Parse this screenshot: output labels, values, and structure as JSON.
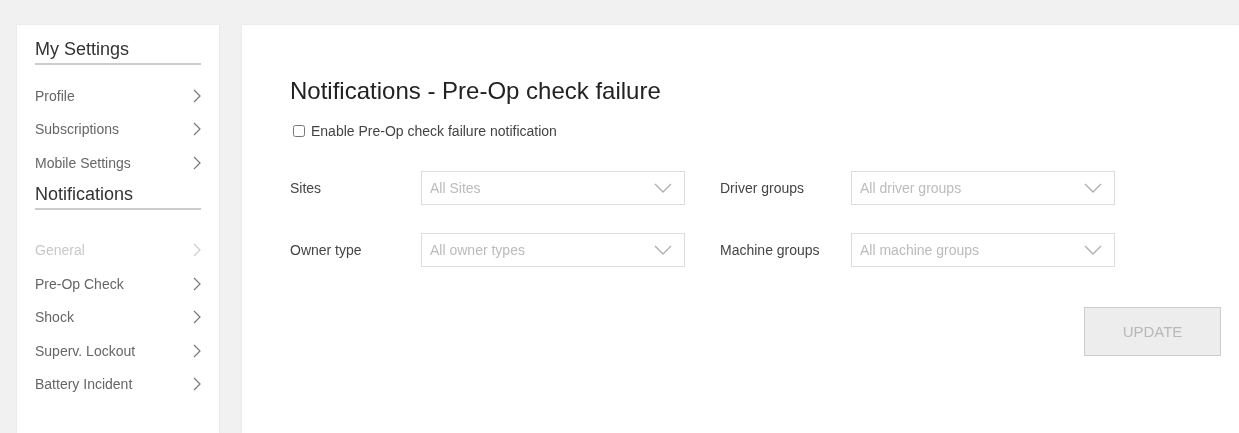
{
  "sidebar": {
    "groups": [
      {
        "heading": "My Settings",
        "items": [
          {
            "label": "Profile",
            "disabled": false
          },
          {
            "label": "Subscriptions",
            "disabled": false
          },
          {
            "label": "Mobile Settings",
            "disabled": false
          }
        ]
      },
      {
        "heading": "Notifications",
        "items": [
          {
            "label": "General",
            "disabled": true
          },
          {
            "label": "Pre-Op Check",
            "disabled": false
          },
          {
            "label": "Shock",
            "disabled": false
          },
          {
            "label": "Superv. Lockout",
            "disabled": false
          },
          {
            "label": "Battery Incident",
            "disabled": false
          }
        ]
      }
    ]
  },
  "main": {
    "title": "Notifications - Pre-Op check failure",
    "enable_checkbox": {
      "label": "Enable Pre-Op check failure notification",
      "checked": false
    },
    "filters": [
      {
        "label": "Sites",
        "placeholder": "All Sites"
      },
      {
        "label": "Driver groups",
        "placeholder": "All driver groups"
      },
      {
        "label": "Owner type",
        "placeholder": "All owner types"
      },
      {
        "label": "Machine groups",
        "placeholder": "All machine groups"
      }
    ],
    "update_button": {
      "label": "UPDATE",
      "disabled": true
    }
  }
}
